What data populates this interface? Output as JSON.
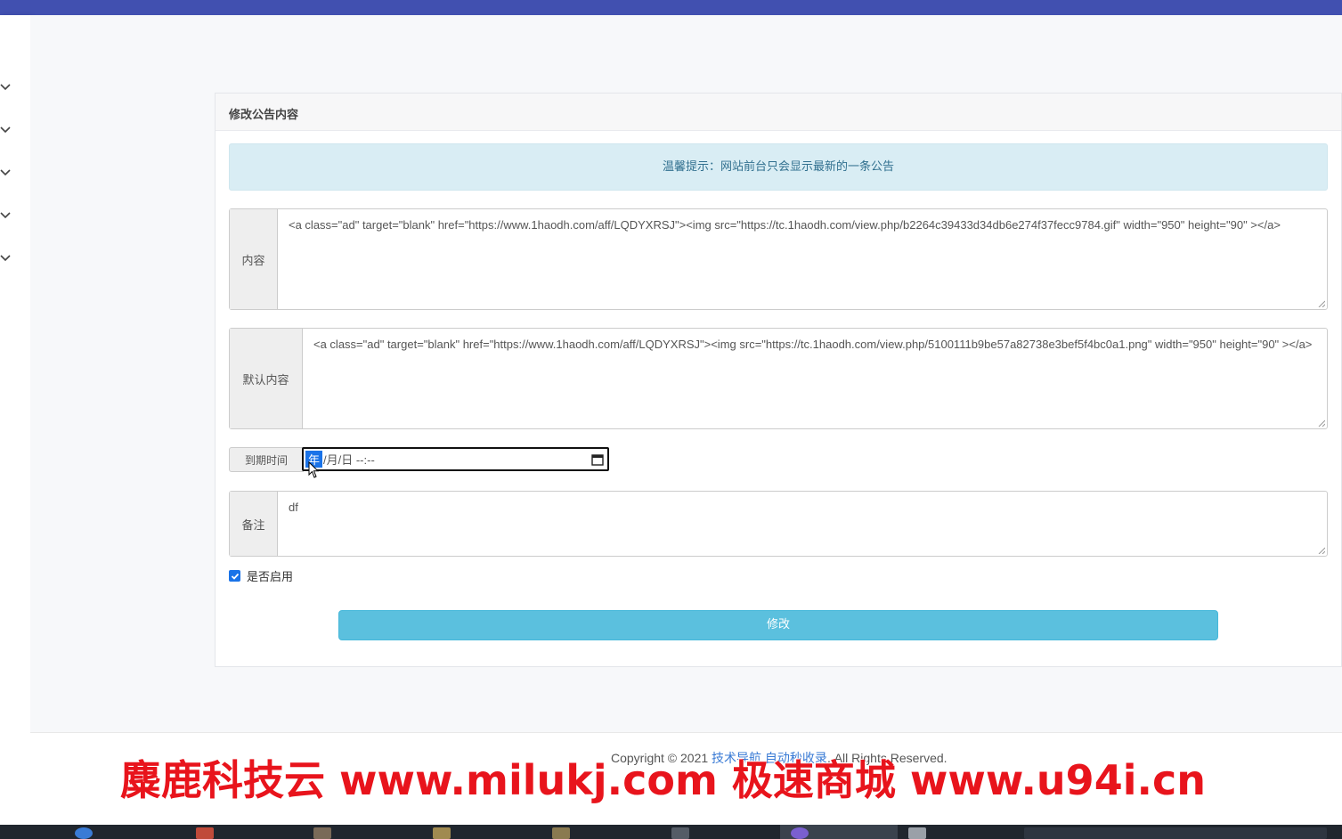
{
  "panel": {
    "title": "修改公告内容",
    "alert": "温馨提示：网站前台只会显示最新的一条公告"
  },
  "form": {
    "content_label": "内容",
    "content_value": "<a class=\"ad\" target=\"blank\" href=\"https://www.1haodh.com/aff/LQDYXRSJ\"><img src=\"https://tc.1haodh.com/view.php/b2264c39433d34db6e274f37fecc9784.gif\" width=\"950\" height=\"90\" ></a>",
    "default_label": "默认内容",
    "default_value": "<a class=\"ad\" target=\"blank\" href=\"https://www.1haodh.com/aff/LQDYXRSJ\"><img src=\"https://tc.1haodh.com/view.php/5100111b9be57a82738e3bef5f4bc0a1.png\" width=\"950\" height=\"90\" ></a>",
    "expire_label": "到期时间",
    "expire_year": "年",
    "expire_rest": "/月/日 --:--",
    "note_label": "备注",
    "note_value": "df",
    "enabled_label": "是否启用",
    "enabled": true,
    "submit_label": "修改"
  },
  "footer": {
    "prefix": "Copyright © 2021",
    "link": "技术导航 自动秒收录",
    "suffix": ". All Rights Reserved."
  },
  "watermark": "麋鹿科技云 www.milukj.com  极速商城 www.u94i.cn",
  "colors": {
    "topbar": "#4150b0",
    "info_bg": "#d9edf4",
    "submit_bg": "#5bc0de",
    "watermark": "#e8141c"
  }
}
